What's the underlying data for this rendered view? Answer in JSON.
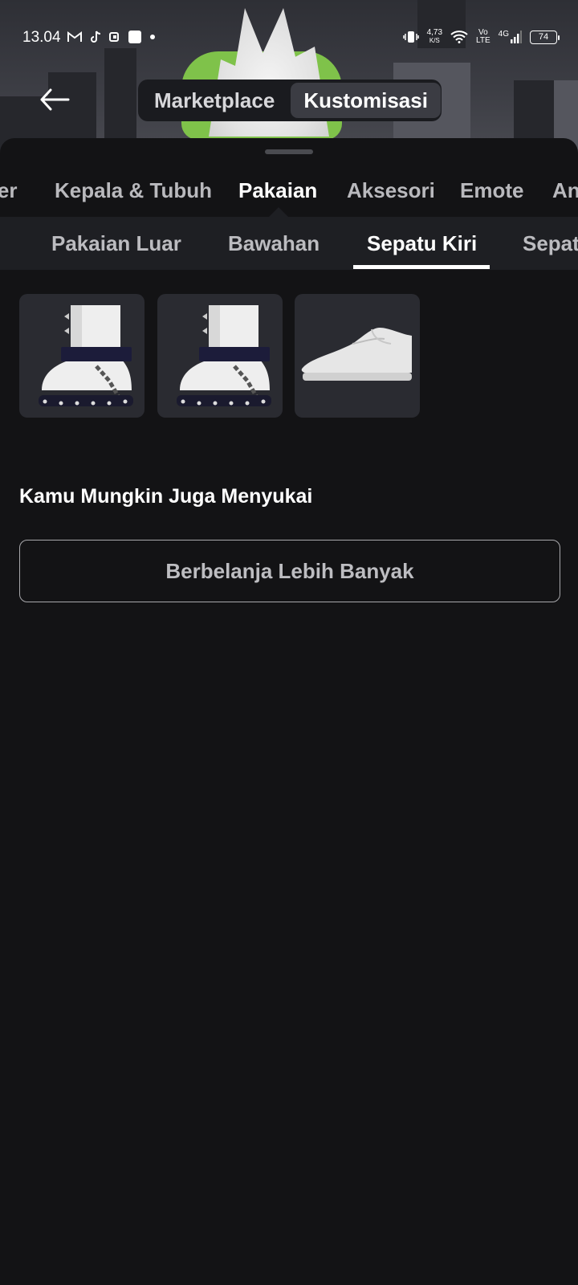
{
  "status_bar": {
    "time": "13.04",
    "net_speed_value": "4,73",
    "net_speed_unit": "K/S",
    "volte_top": "Vo",
    "volte_bottom": "LTE",
    "network": "4G",
    "battery": "74",
    "icons": [
      "gmail-icon",
      "tiktok-icon",
      "app-icon",
      "square-notification-icon",
      "dot-icon",
      "vibrate-icon",
      "wifi-icon",
      "signal-icon",
      "battery-icon"
    ]
  },
  "header": {
    "back_icon": "arrow-left-icon",
    "segments": [
      {
        "label": "Marketplace",
        "active": false
      },
      {
        "label": "Kustomisasi",
        "active": true
      }
    ]
  },
  "category_tabs": [
    {
      "label": "Karakter",
      "active": false
    },
    {
      "label": "Kepala & Tubuh",
      "active": false
    },
    {
      "label": "Pakaian",
      "active": true
    },
    {
      "label": "Aksesori",
      "active": false
    },
    {
      "label": "Emote",
      "active": false
    },
    {
      "label": "Animasi",
      "active": false
    }
  ],
  "sub_tabs": [
    {
      "label": "Pakaian Luar",
      "active": false
    },
    {
      "label": "Bawahan",
      "active": false
    },
    {
      "label": "Sepatu Kiri",
      "active": true
    },
    {
      "label": "Sepatu Kanan",
      "active": false
    }
  ],
  "items": [
    {
      "type": "spiked-boot"
    },
    {
      "type": "spiked-boot"
    },
    {
      "type": "slip-on-shoe"
    }
  ],
  "recommendations": {
    "title": "Kamu Mungkin Juga Menyukai",
    "shop_button": "Berbelanja Lebih Banyak"
  },
  "colors": {
    "background": "#131315",
    "tab_bar": "#1e1f23",
    "item_card": "#2a2b31",
    "avatar_green": "#7fc24a"
  }
}
